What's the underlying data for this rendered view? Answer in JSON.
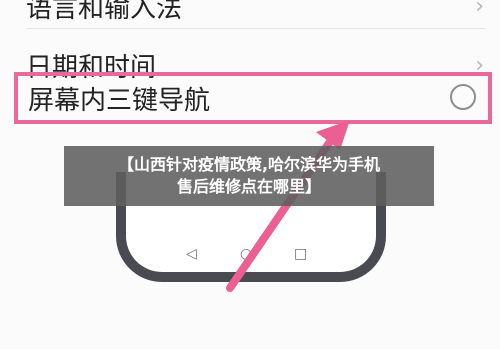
{
  "settings": {
    "prev_row_label": "语言和输入法",
    "date_row_label": "日期和时间",
    "nav_row_label": "屏幕内三键导航",
    "chevron": "›"
  },
  "phone_nav": {
    "back": "◁",
    "home": "○",
    "recent": "□"
  },
  "banner": {
    "line1": "【山西针对疫情政策,哈尔滨华为手机",
    "line2": "售后维修点在哪里】"
  },
  "colors": {
    "highlight": "#e96a9a",
    "arrow": "#ec5f92",
    "phone_frame": "#4a4a52"
  }
}
